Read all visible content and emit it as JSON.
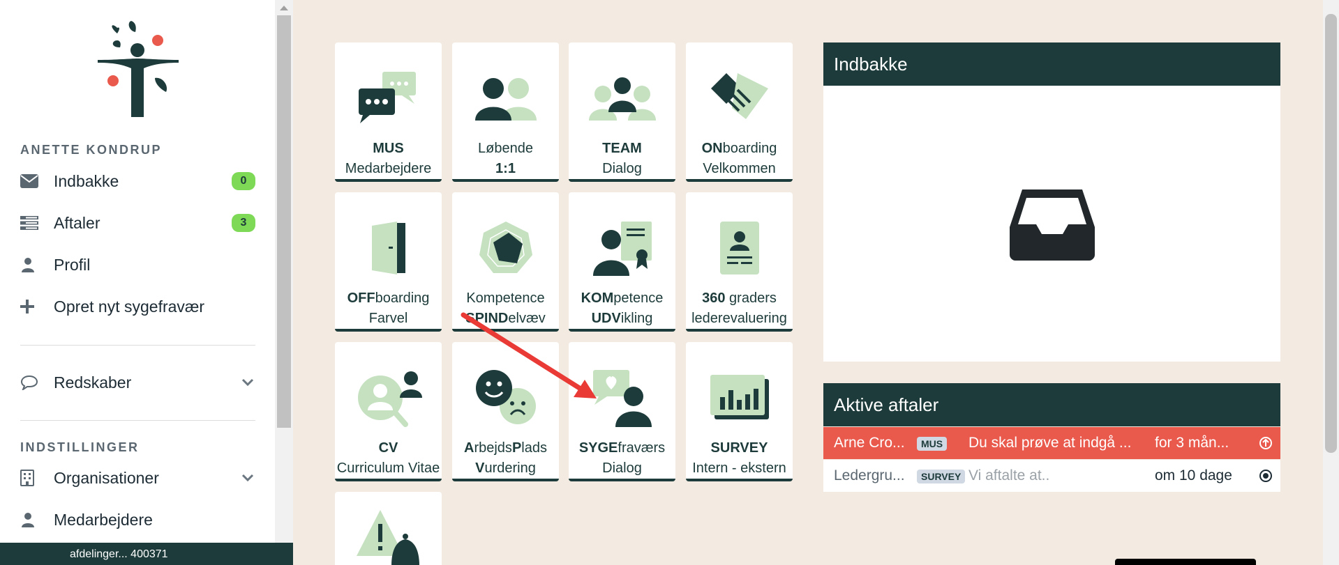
{
  "user": {
    "name": "ANETTE KONDRUP"
  },
  "nav": {
    "inbox": {
      "label": "Indbakke",
      "icon": "envelope-icon",
      "count": "0"
    },
    "appointments": {
      "label": "Aftaler",
      "icon": "list-icon",
      "count": "3"
    },
    "profile": {
      "label": "Profil",
      "icon": "user-icon"
    },
    "sick": {
      "label": "Opret nyt sygefravær",
      "icon": "plus-icon"
    },
    "tools": {
      "label": "Redskaber",
      "icon": "speech-bubble-icon"
    }
  },
  "settings": {
    "title": "INDSTILLINGER",
    "orgs": {
      "label": "Organisationer",
      "icon": "building-icon"
    },
    "employees": {
      "label": "Medarbejdere",
      "icon": "user-icon"
    }
  },
  "footer": {
    "text": "afdelinger... 400371"
  },
  "tiles": [
    {
      "b1": "MUS",
      "r1": "",
      "b2": "",
      "r2": "Medarbejdere",
      "icon": "chat-bubbles-icon"
    },
    {
      "b1": "",
      "r1": "Løbende",
      "b2": "1:1",
      "r2": "",
      "icon": "two-people-icon"
    },
    {
      "b1": "TEAM",
      "r1": "",
      "b2": "",
      "r2": "Dialog",
      "icon": "team-icon"
    },
    {
      "b1": "ON",
      "r1": "boarding",
      "b2": "",
      "r2": "Velkommen",
      "icon": "handshake-icon"
    },
    {
      "b1": "OFF",
      "r1": "boarding",
      "b2": "",
      "r2": "Farvel",
      "icon": "door-icon"
    },
    {
      "b1": "",
      "r1": "Kompetence",
      "b2": "SPIND",
      "r2": "elvæv",
      "icon": "spider-web-icon"
    },
    {
      "b1": "KOM",
      "r1": "petence",
      "b2": "UDV",
      "r2": "ikling",
      "icon": "certificate-icon"
    },
    {
      "b1": "360",
      "r1": " graders",
      "b2": "",
      "r2": "lederevaluering",
      "icon": "id-card-icon"
    },
    {
      "b1": "CV",
      "r1": "",
      "b2": "",
      "r2": "Curriculum Vitae",
      "icon": "search-person-icon"
    },
    {
      "l1": [
        [
          "A",
          true
        ],
        [
          "rbejds",
          false
        ],
        [
          "P",
          true
        ],
        [
          "lads",
          false
        ]
      ],
      "b2": "V",
      "r2": "urdering",
      "icon": "faces-icon"
    },
    {
      "b1": "SYGE",
      "r1": "fraværs",
      "b2": "",
      "r2": "Dialog",
      "icon": "sick-dialog-icon"
    },
    {
      "b1": "SURVEY",
      "r1": "",
      "b2": "",
      "r2": "Intern - ekstern",
      "icon": "bar-chart-icon"
    },
    {
      "icon": "warning-bell-icon"
    }
  ],
  "inbox_panel": {
    "title": "Indbakke",
    "icon": "inbox-tray-icon"
  },
  "appointments_panel": {
    "title": "Aktive aftaler",
    "rows": [
      {
        "name": "Arne Cro...",
        "tag": "MUS",
        "desc": "Du skal prøve at indgå ...",
        "when": "for 3 mån...",
        "action_icon": "arrow-up-circle-icon"
      },
      {
        "name": "Ledergru...",
        "tag": "SURVEY",
        "desc": "Vi aftalte at..",
        "when": "om 10 dage",
        "action_icon": "dot-circle-icon"
      }
    ]
  },
  "colors": {
    "dark_green": "#1d3b3a",
    "light_green": "#c5e1c0",
    "accent_red": "#e9594c",
    "badge_green": "#7ed957",
    "background": "#f3ebe1"
  }
}
